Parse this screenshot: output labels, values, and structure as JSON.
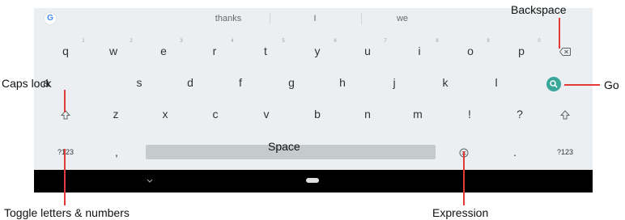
{
  "suggestions": [
    "thanks",
    "I",
    "we"
  ],
  "google_logo": "G",
  "rows": {
    "row1": [
      {
        "label": "q",
        "hint": "1"
      },
      {
        "label": "w",
        "hint": "2"
      },
      {
        "label": "e",
        "hint": "3"
      },
      {
        "label": "r",
        "hint": "4"
      },
      {
        "label": "t",
        "hint": "5"
      },
      {
        "label": "y",
        "hint": "6"
      },
      {
        "label": "u",
        "hint": "7"
      },
      {
        "label": "i",
        "hint": "8"
      },
      {
        "label": "o",
        "hint": "9"
      },
      {
        "label": "p",
        "hint": "0"
      }
    ],
    "row2": [
      "a",
      "s",
      "d",
      "f",
      "g",
      "h",
      "j",
      "k",
      "l"
    ],
    "row3": [
      "z",
      "x",
      "c",
      "v",
      "b",
      "n",
      "m",
      "!",
      "?"
    ],
    "row4": {
      "left_symbols": "?123",
      "comma": ",",
      "period": ".",
      "right_symbols": "?123"
    }
  },
  "annotations": {
    "backspace": "Backspace",
    "caps_lock": "Caps lock",
    "go": "Go",
    "space": "Space",
    "toggle": "Toggle letters & numbers",
    "expression": "Expression"
  },
  "colors": {
    "accent_go": "#3aa79b",
    "leader_lines": "#e53935",
    "keyboard_bg": "#eceff1",
    "navbar": "#000000"
  },
  "icons": [
    "google-logo",
    "backspace-icon",
    "shift-icon",
    "search-icon",
    "emoji-icon",
    "chevron-down-icon",
    "home-pill-icon"
  ]
}
